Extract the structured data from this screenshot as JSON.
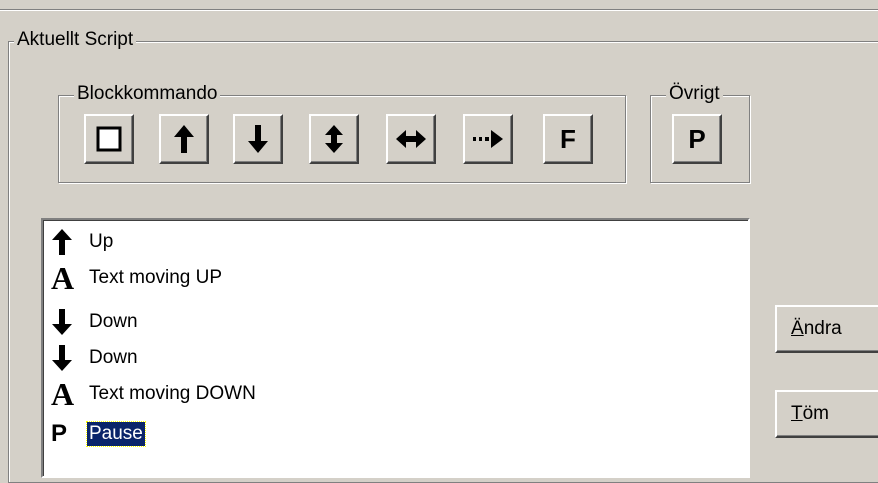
{
  "groups": {
    "current_script": "Aktuellt Script",
    "block_commands": "Blockkommando",
    "other": "Övrigt"
  },
  "block_buttons": [
    {
      "icon": "square-icon",
      "label": ""
    },
    {
      "icon": "arrow-up-icon",
      "label": ""
    },
    {
      "icon": "arrow-down-icon",
      "label": ""
    },
    {
      "icon": "arrow-up-down-icon",
      "label": ""
    },
    {
      "icon": "arrow-left-right-icon",
      "label": ""
    },
    {
      "icon": "dotted-arrow-right-icon",
      "label": ""
    },
    {
      "icon": "letter-f-icon",
      "label": "F"
    }
  ],
  "other_buttons": [
    {
      "icon": "letter-p-icon",
      "label": "P"
    }
  ],
  "script_list": [
    {
      "icon": "arrow-up-icon",
      "glyph": "",
      "text": "Up",
      "selected": false
    },
    {
      "icon": "letter-a-icon",
      "glyph": "A",
      "text": "Text moving UP",
      "selected": false
    },
    {
      "icon": "arrow-down-icon",
      "glyph": "",
      "text": "Down",
      "selected": false
    },
    {
      "icon": "arrow-down-icon",
      "glyph": "",
      "text": "Down",
      "selected": false
    },
    {
      "icon": "letter-a-icon",
      "glyph": "A",
      "text": "Text moving DOWN",
      "selected": false
    },
    {
      "icon": "letter-p-icon",
      "glyph": "P",
      "text": "Pause",
      "selected": true
    }
  ],
  "side_buttons": {
    "change": {
      "accel": "Ä",
      "rest": "ndra"
    },
    "clear": {
      "accel": "T",
      "rest": "öm"
    }
  }
}
